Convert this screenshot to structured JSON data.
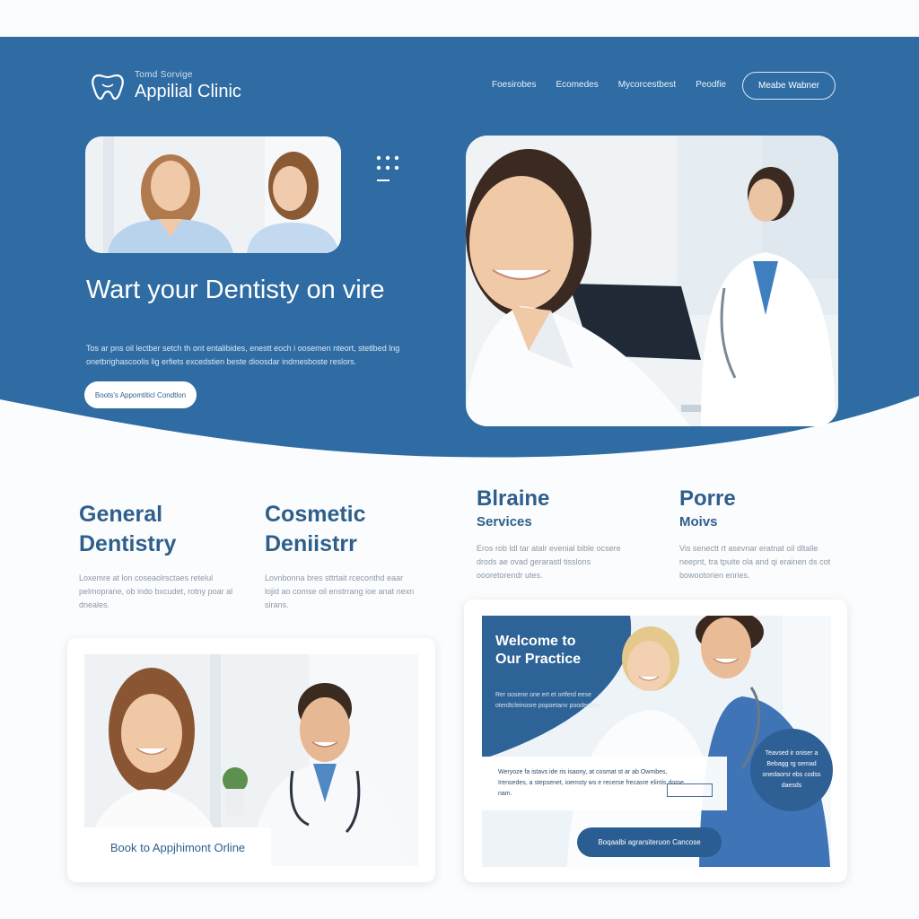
{
  "brand": {
    "tagline": "Tomd Sorvige",
    "name": "Appilial Clinic"
  },
  "nav": {
    "items": [
      "Foesirobes",
      "Ecomedes",
      "Mycorcestbest",
      "Peodfie"
    ],
    "button_label": "Meabe Wabner"
  },
  "hero": {
    "title": "Wart your Dentisty on vire",
    "body": "Tos ar pns oil lectber setch th ont entalibides, enestt eoch i oosemen nteort, stetlbed lng onetbrighascoolis lig erfiets excedstien beste dioosdar indmesboste reslors.",
    "cta_label": "Boots's Appomtiticl Condtlon"
  },
  "services": [
    {
      "title": "General Dentistry",
      "body": "Loxemre at lon coseaolrsctaes retelul pelmoprane, ob indo bxcudet, rotny poar al dneales."
    },
    {
      "title": "Cosmetic Deniistrr",
      "body": "Lovnbonna bres sttrtait rceconthd eaar lojid ao comse oil enstrrang ioe anat nexn sirans."
    },
    {
      "title": "Blraine",
      "subtitle": "Services",
      "body": "Eros rob ldl tar atalr evenial bible ocsere drods ae ovad gerarastl tisslons oooretorendr utes."
    },
    {
      "title": "Porre",
      "subtitle": "Moivs",
      "body": "Vis senectt rt asevnar eratnat oil dltalle neepnt, tra tpuite ola and qi erainen ds cot bowootorien enries."
    }
  ],
  "book_online_label": "Book to Appjhimont Orline",
  "welcome": {
    "title": "Welcome to Our Practice",
    "body": "Rer oosene one ert et ortferd eese oterdtcleinosre popoetanv poodeeres",
    "info_text": "Weryoze fa istavs ide ris isaony, at cosmat st ar ab Owmbes, Irensedes, a stepsenet, ioemsty ws e recerse frecasre elintis dome nam.",
    "badge_text": "Teavsed ir oniser a Bebagg rg semad onedaorsr ebs codss daesds",
    "book_button_label": "Boqaalbi agrarsiteruon Cancose"
  },
  "colors": {
    "brand_blue": "#2f6ca3",
    "dark_blue": "#2a5d92",
    "heading_blue": "#2e5f8c"
  }
}
